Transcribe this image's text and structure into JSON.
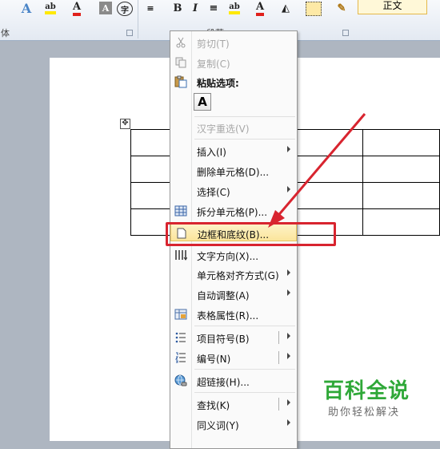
{
  "ribbon": {
    "group_left_label": "体",
    "group_middle_label": "段落",
    "style_box": "正文",
    "button_bold": "B",
    "button_italic": "I",
    "font_color_letter": "A",
    "char_border_letter": "A",
    "phonetic_char": "字",
    "highlight_label": "ab"
  },
  "menu": {
    "paste_box_letter": "A",
    "items": [
      {
        "label": "剪切(T)",
        "icon": "scissors-icon",
        "disabled": true
      },
      {
        "label": "复制(C)",
        "icon": "copy-icon",
        "disabled": true
      },
      {
        "label": "粘贴选项:",
        "icon": "paste-icon",
        "bold": true
      },
      {
        "label": "汉字重选(V)",
        "disabled": true
      },
      {
        "label": "插入(I)",
        "submenu": true
      },
      {
        "label": "删除单元格(D)..."
      },
      {
        "label": "选择(C)",
        "submenu": true
      },
      {
        "label": "拆分单元格(P)...",
        "icon": "split-cells-icon"
      },
      {
        "label": "边框和底纹(B)...",
        "icon": "document-icon",
        "highlighted": true
      },
      {
        "label": "文字方向(X)...",
        "icon": "text-direction-icon"
      },
      {
        "label": "单元格对齐方式(G)",
        "submenu": true
      },
      {
        "label": "自动调整(A)",
        "submenu": true
      },
      {
        "label": "表格属性(R)...",
        "icon": "table-properties-icon"
      },
      {
        "label": "项目符号(B)",
        "icon": "bullets-icon",
        "submenu": true,
        "split": true
      },
      {
        "label": "编号(N)",
        "icon": "numbering-icon",
        "submenu": true,
        "split": true
      },
      {
        "label": "超链接(H)...",
        "icon": "hyperlink-icon"
      },
      {
        "label": "查找(K)",
        "submenu": true,
        "split": true
      },
      {
        "label": "同义词(Y)",
        "submenu": true
      }
    ]
  },
  "watermark": {
    "title": "百科全说",
    "subtitle": "助你轻松解决"
  },
  "colors": {
    "highlight_red": "#d8242f",
    "watermark_green": "#2fa838",
    "menu_hover": "#fbe59b"
  }
}
